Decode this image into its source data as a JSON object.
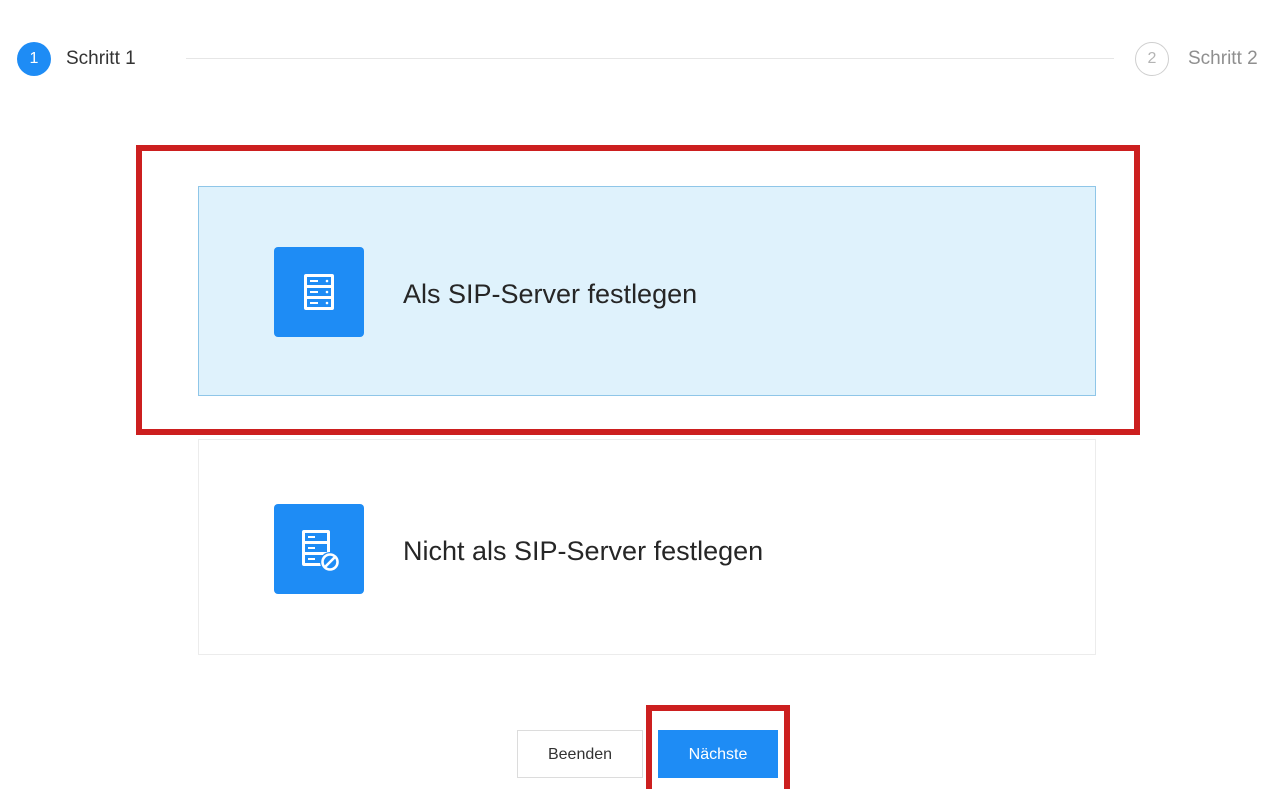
{
  "stepper": {
    "steps": [
      {
        "number": "1",
        "label": "Schritt 1",
        "state": "active"
      },
      {
        "number": "2",
        "label": "Schritt 2",
        "state": "inactive"
      }
    ]
  },
  "options": [
    {
      "label": "Als SIP-Server festlegen",
      "icon": "server-icon",
      "selected": true
    },
    {
      "label": "Nicht als SIP-Server festlegen",
      "icon": "server-disabled-icon",
      "selected": false
    }
  ],
  "buttons": {
    "cancel_label": "Beenden",
    "next_label": "Nächste"
  },
  "colors": {
    "accent": "#1e8cf5",
    "selected_background": "#dff2fc",
    "highlight": "#cc1f1f"
  }
}
